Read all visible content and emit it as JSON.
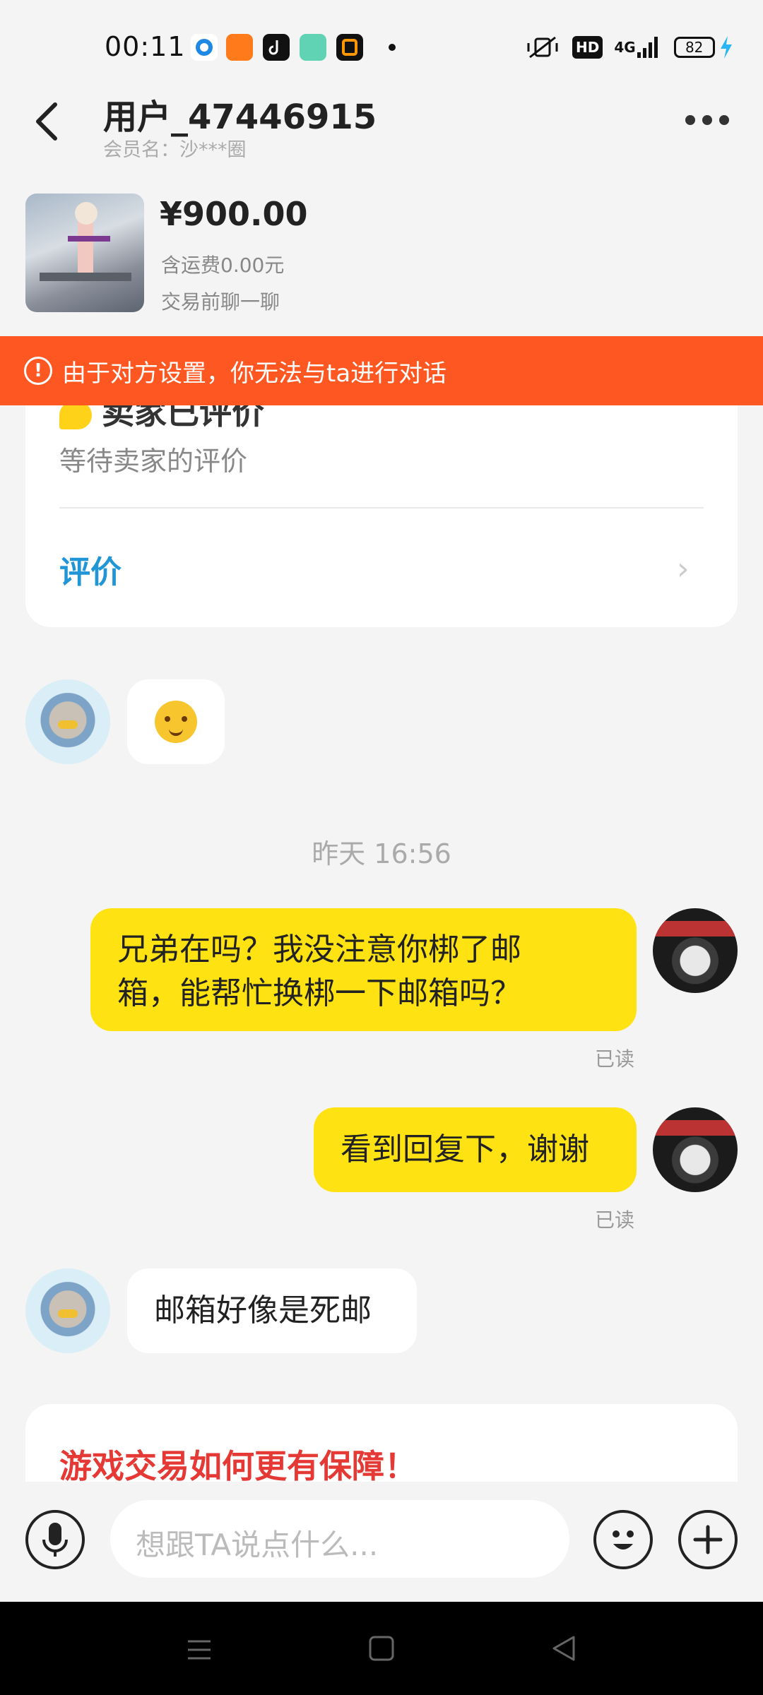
{
  "status_bar": {
    "time": "00:11",
    "network": "4G",
    "hd": "HD",
    "battery": "82"
  },
  "header": {
    "contact_name": "用户_47446915",
    "member_label": "会员名：沙***圈"
  },
  "product": {
    "price": "¥900.00",
    "shipping": "含运费0.00元",
    "chat_tip": "交易前聊一聊"
  },
  "banner": {
    "icon": "!",
    "text": "由于对方设置，你无法与ta进行对话"
  },
  "review_card": {
    "title": "卖家已评价",
    "subtitle": "等待卖家的评价",
    "link": "评价",
    "chevron": "›"
  },
  "chat": {
    "timestamp": "昨天 16:56",
    "messages": [
      {
        "side": "left",
        "type": "emoji"
      },
      {
        "side": "right",
        "text_line1": "兄弟在吗？我没注意你梆了邮",
        "text_line2": "箱，能帮忙换梆一下邮箱吗？",
        "read": "已读"
      },
      {
        "side": "right",
        "text": "看到回复下，谢谢",
        "read": "已读"
      },
      {
        "side": "left",
        "text": "邮箱好像是死邮"
      }
    ]
  },
  "info_card": {
    "title": "游戏交易如何更有保障！"
  },
  "input_bar": {
    "placeholder": "想跟TA说点什么..."
  },
  "icons": [
    "back-arrow-icon",
    "more-icon",
    "alert-icon",
    "chevron-right-icon",
    "microphone-icon",
    "emoji-icon",
    "plus-icon",
    "menu-icon",
    "home-icon",
    "back-triangle-icon"
  ],
  "colors": {
    "banner": "#ff5722",
    "my_bubble": "#ffe212",
    "link_blue": "#2196d6",
    "info_red": "#e53935"
  }
}
